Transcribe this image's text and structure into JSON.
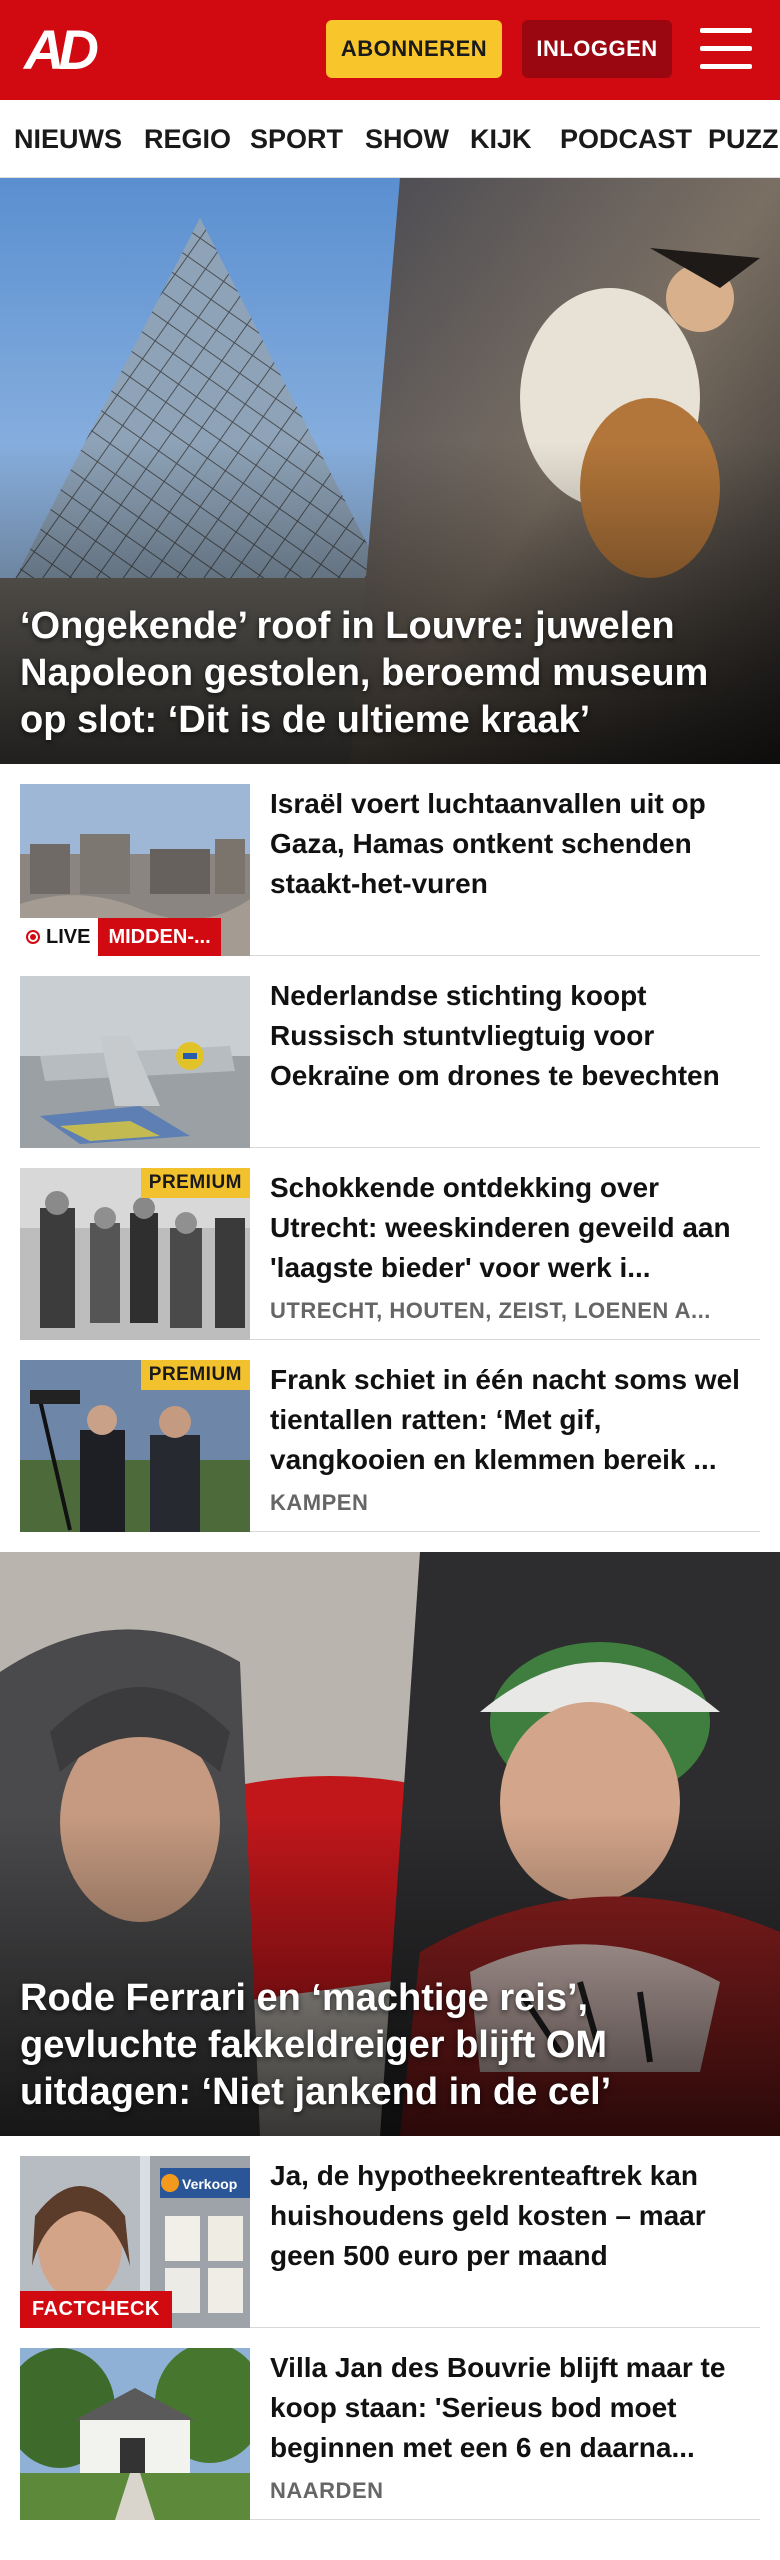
{
  "header": {
    "logo": "AD",
    "subscribe_label": "ABONNEREN",
    "login_label": "INLOGGEN"
  },
  "nav": {
    "items": [
      "NIEUWS",
      "REGIO",
      "SPORT",
      "SHOW",
      "KIJK",
      "PODCAST",
      "PUZZ"
    ]
  },
  "hero1": {
    "title": "‘Ongekende’ roof in Louvre: juwelen Napoleon gestolen, beroemd museum op slot: ‘Dit is de ultieme kraak’"
  },
  "articles": [
    {
      "title": "Israël voert luchtaanvallen uit op Gaza, Hamas ontkent schenden staakt-het-vuren",
      "live_label": "LIVE",
      "live_region": "MIDDEN-..."
    },
    {
      "title": "Nederlandse stichting koopt Russisch stuntvliegtuig voor Oekraïne om drones te bevechten"
    },
    {
      "title": "Schokkende ontdekking over Utrecht: weeskinderen geveild aan 'laagste bieder' voor werk i...",
      "badge": "PREMIUM",
      "location": "UTRECHT, HOUTEN, ZEIST, LOENEN A..."
    },
    {
      "title": "Frank schiet in één nacht soms wel tientallen ratten: ‘Met gif, vangkooien en klemmen bereik ...",
      "badge": "PREMIUM",
      "location": "KAMPEN"
    }
  ],
  "hero2": {
    "title": "Rode Ferrari en ‘machtige reis’, gevluchte fakkeldreiger blijft OM uitdagen: ‘Niet jankend in de cel’"
  },
  "articles2": [
    {
      "title": "Ja, de hypotheekrenteaftrek kan huishoudens geld kosten – maar geen 500 euro per maand",
      "badge": "FACTCHECK",
      "thumb_sign": "Verkoop"
    },
    {
      "title": "Villa Jan des Bouvrie blijft maar te koop staan: 'Serieus bod moet beginnen met een 6 en daarna...",
      "location": "NAARDEN"
    }
  ],
  "colors": {
    "brand_red": "#d10a11",
    "subscribe_yellow": "#f8c52b",
    "login_dark_red": "#9a0710",
    "premium_yellow": "#f2c12e"
  }
}
